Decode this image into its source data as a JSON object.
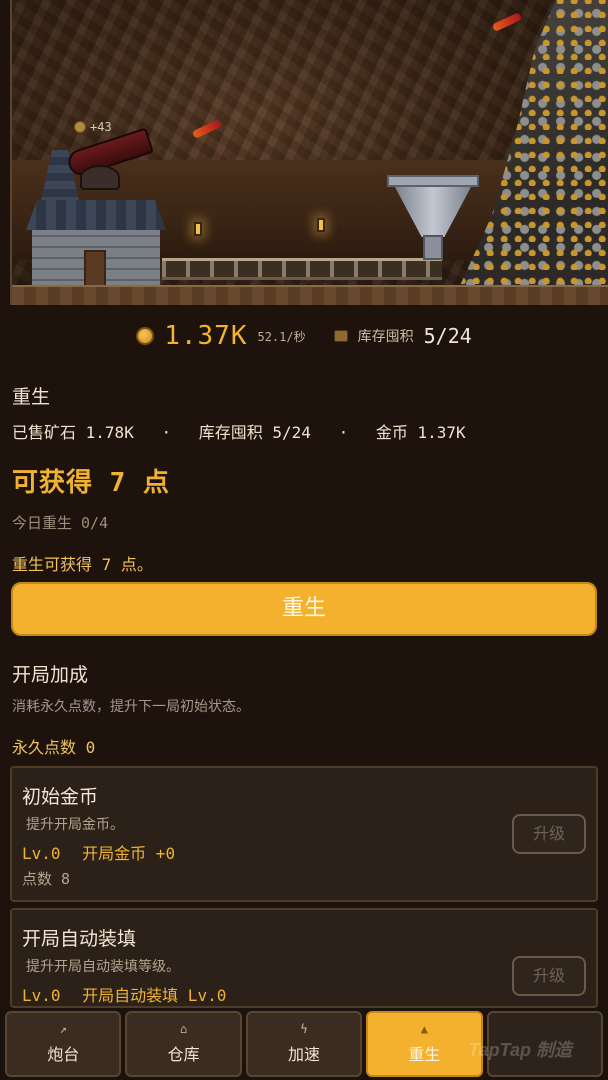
{
  "scene": {
    "float_gain": "+43"
  },
  "stats": {
    "gold": "1.37K",
    "rate": "52.1/秒",
    "stash_label": "库存囤积",
    "stash_value": "5/24"
  },
  "rebirth": {
    "title": "重生",
    "sold_ore_label": "已售矿石",
    "sold_ore_value": "1.78K",
    "stash_label": "库存囤积",
    "stash_value": "5/24",
    "gold_label": "金币",
    "gold_value": "1.37K",
    "separator": "·",
    "obtainable": "可获得 7 点",
    "today": "今日重生 0/4",
    "note": "重生可获得 7 点。",
    "button_label": "重生"
  },
  "bonus": {
    "title": "开局加成",
    "description": "消耗永久点数，提升下一局初始状态。",
    "points": "永久点数 0",
    "cards": [
      {
        "title": "初始金币",
        "desc": "提升开局金币。",
        "level": "Lv.0",
        "effect": "开局金币 +0",
        "cost": "点数 8",
        "button": "升级"
      },
      {
        "title": "开局自动装填",
        "desc": "提升开局自动装填等级。",
        "level": "Lv.0",
        "effect": "开局自动装填 Lv.0",
        "button": "升级"
      }
    ]
  },
  "nav": {
    "tabs": [
      {
        "label": "炮台",
        "icon": "cannon-icon"
      },
      {
        "label": "仓库",
        "icon": "warehouse-icon"
      },
      {
        "label": "加速",
        "icon": "lightning-icon"
      },
      {
        "label": "重生",
        "icon": "rebirth-icon",
        "active": true
      },
      {
        "label": "",
        "icon": ""
      }
    ]
  },
  "watermark": "TapTap 制造",
  "colors": {
    "accent": "#f3b12e",
    "gold_text": "#f0b233",
    "background": "#1d130c"
  }
}
